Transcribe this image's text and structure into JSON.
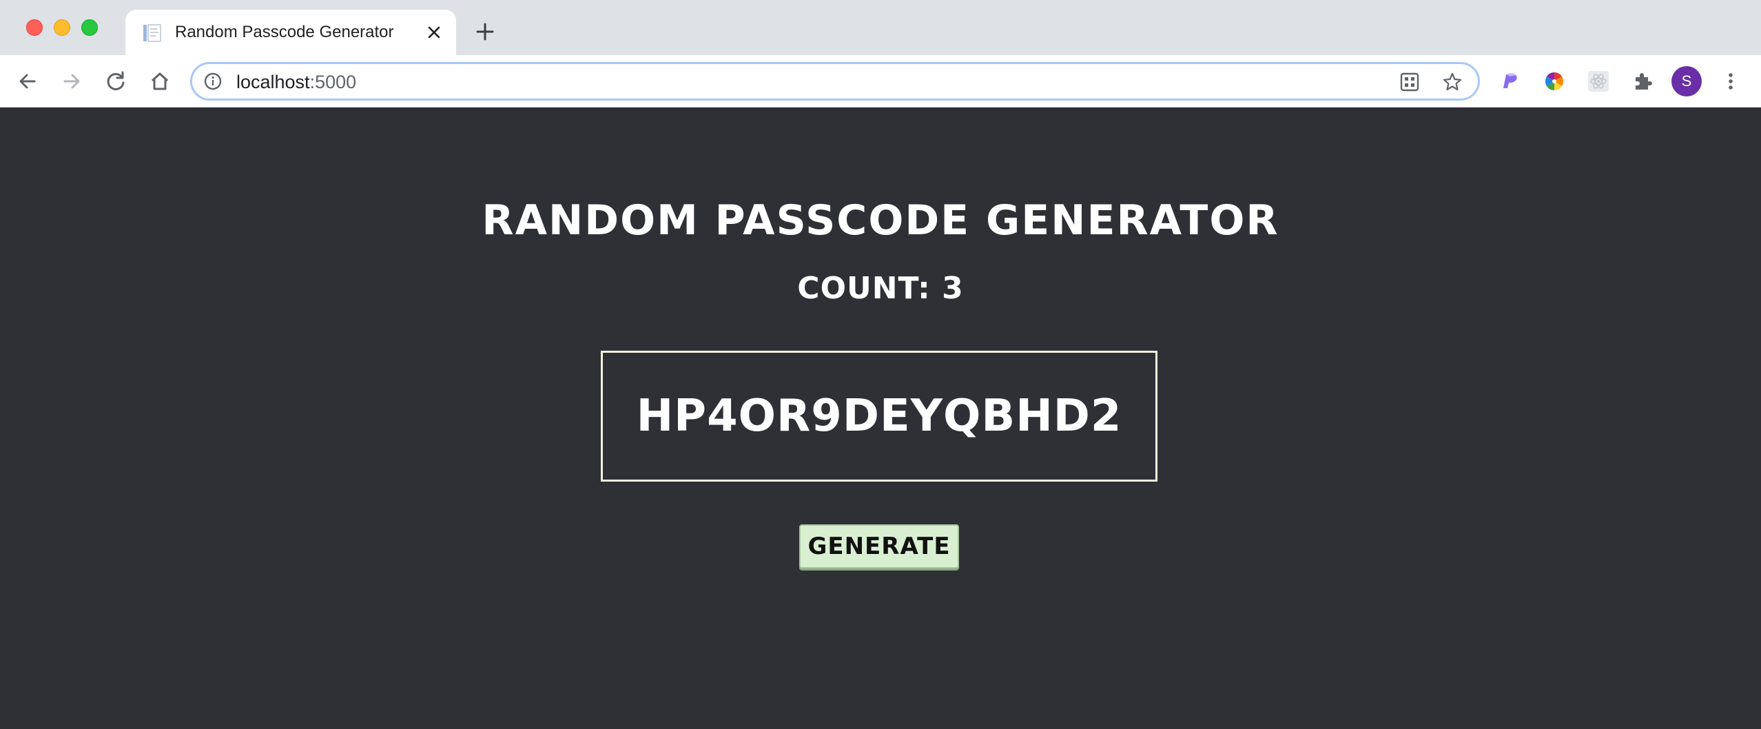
{
  "browser": {
    "tab": {
      "title": "Random Passcode Generator",
      "favicon": "document-icon"
    },
    "address_bar": {
      "host": "localhost",
      "port": ":5000"
    },
    "profile_initial": "S",
    "icons": [
      "back-icon",
      "forward-icon",
      "reload-icon",
      "home-icon",
      "info-icon",
      "qr-code-icon",
      "bookmark-star-icon",
      "extension-icon",
      "menu-icon"
    ]
  },
  "page": {
    "title": "RANDOM PASSCODE GENERATOR",
    "count_label": "COUNT: 3",
    "passcode": "HP4OR9DEYQBHD2",
    "generate_label": "GENERATE"
  },
  "colors": {
    "page_background": "#2f3036",
    "text": "#ffffff",
    "passcode_border": "#f5f0dc",
    "button_background": "#d9efd2",
    "avatar": "#6a2fa8",
    "omnibox_focus": "#a8c7fa"
  }
}
